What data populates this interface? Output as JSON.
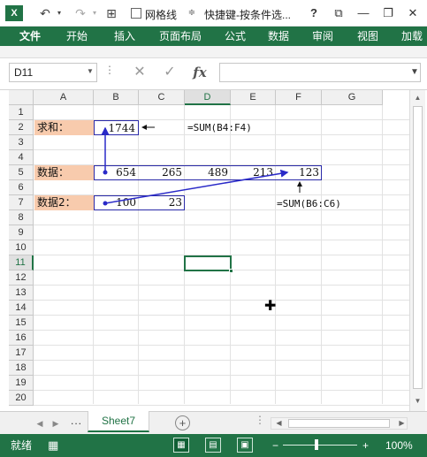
{
  "titlebar": {
    "app_icon": "X",
    "undo_icon": "undo-icon",
    "redo_icon": "redo-icon",
    "gridlines_label": "网格线",
    "title": "快捷键-按条件选...",
    "help": "?",
    "minimize": "—",
    "close": "✕"
  },
  "ribbon": {
    "tabs": [
      "文件",
      "开始",
      "插入",
      "页面布局",
      "公式",
      "数据",
      "审阅",
      "视图",
      "加载"
    ]
  },
  "formula_bar": {
    "name_box": "D11",
    "cancel": "✕",
    "enter": "✓",
    "fx": "fx",
    "formula": ""
  },
  "grid": {
    "columns": [
      "A",
      "B",
      "C",
      "D",
      "E",
      "F",
      "G"
    ],
    "rows": [
      "1",
      "2",
      "3",
      "4",
      "5",
      "6",
      "7",
      "8",
      "9",
      "10",
      "11",
      "12",
      "13",
      "14",
      "15",
      "16",
      "17",
      "18",
      "19",
      "20"
    ],
    "selected_column": "D",
    "selected_row": "11",
    "cells": {
      "a2": "求和：",
      "b2": "1744",
      "a5": "数据：",
      "b5": "654",
      "c5": "265",
      "d5": "489",
      "e5": "213",
      "f5": "123",
      "a7": "数据2：",
      "b7": "100",
      "c7": "23"
    },
    "notes": {
      "sum_formula": "=SUM(B4:F4)",
      "sum2_formula": "=SUM(B6:C6)"
    }
  },
  "sheets": {
    "more": "...",
    "active": "Sheet7",
    "add": "+"
  },
  "status": {
    "ready": "就绪",
    "zoom_minus": "−",
    "zoom_plus": "+",
    "zoom": "100%"
  },
  "colors": {
    "accent": "#217346",
    "label_fill": "#f8cbad",
    "arrow": "#2a2ac8"
  }
}
